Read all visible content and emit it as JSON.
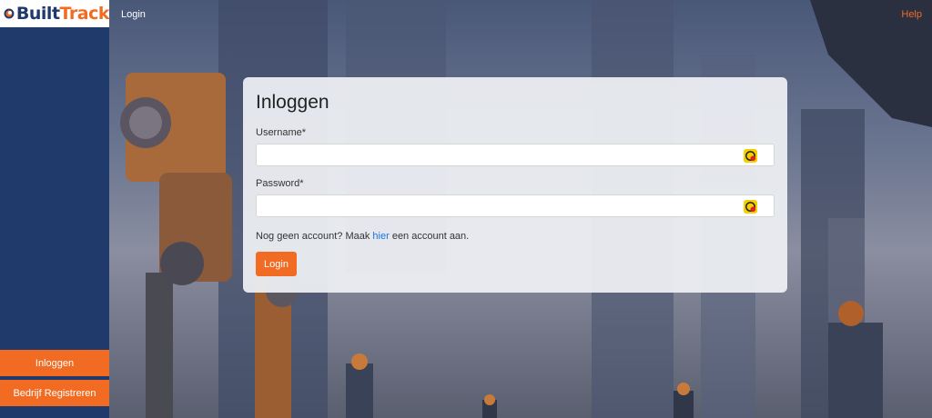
{
  "app": {
    "logo_text_a": "Built",
    "logo_text_b": "Track",
    "brand_color": "#1f3a6b",
    "accent_color": "#f26b23"
  },
  "topnav": {
    "left_label": "Login",
    "help_label": "Help"
  },
  "sidebar": {
    "items": [
      {
        "label": "Inloggen",
        "icon": "none"
      },
      {
        "label": "Bedrijf Registreren",
        "icon": "none"
      }
    ]
  },
  "form": {
    "title": "Inloggen",
    "username_label": "Username*",
    "username_value": "",
    "password_label": "Password*",
    "password_value": "",
    "field_icon": "password-manager-icon",
    "note_prefix": "Nog geen account? Maak ",
    "note_link": "hier",
    "note_suffix": " een account aan.",
    "submit_label": "Login"
  }
}
